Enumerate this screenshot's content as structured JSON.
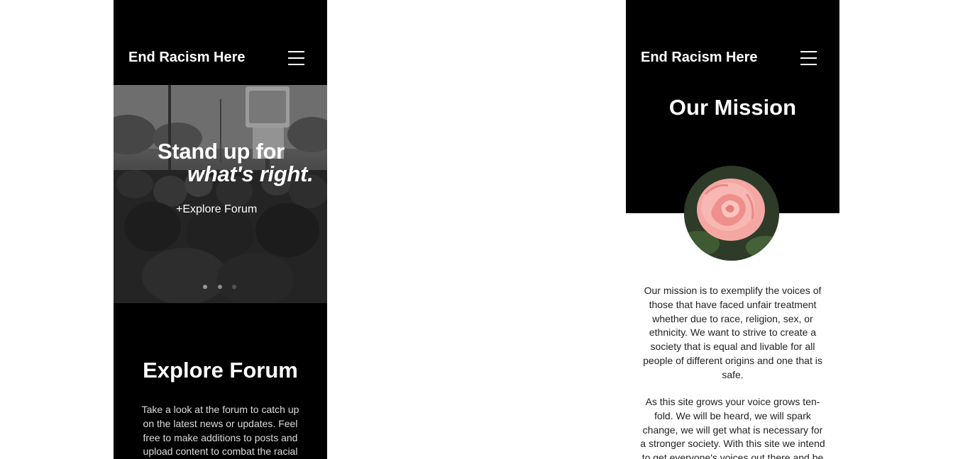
{
  "left_page": {
    "header": {
      "site_title": "End Racism Here",
      "menu_icon": "hamburger-menu-icon"
    },
    "hero": {
      "headline_line1": "Stand up for",
      "headline_line2": "what's right.",
      "cta_link": "+Explore Forum",
      "slides_count": 3,
      "active_slide": 1
    },
    "explore": {
      "title": "Explore Forum",
      "text": "Take a look at the forum to catch up on the latest news or updates. Feel free to make additions to posts and upload content to combat the racial"
    }
  },
  "right_page": {
    "header": {
      "site_title": "End Racism Here",
      "menu_icon": "hamburger-menu-icon"
    },
    "mission": {
      "title": "Our Mission",
      "image": "rose-image",
      "paragraph1": "Our mission is to exemplify the voices of those that have faced unfair treatment whether due to race, religion, sex, or ethnicity. We want to strive to create a society that is equal and livable for all people of different origins and one that is safe.",
      "paragraph2": "As this site grows your voice grows ten-fold. We will be heard, we will spark change, we will get what is necessary for a stronger society. With this site we intend to get everyone's voices out there and be"
    }
  },
  "colors": {
    "background": "#ffffff",
    "header_bg": "#000000",
    "text_light": "#ffffff",
    "text_dark": "#222222",
    "dot_active": "#9a9a9a",
    "dot_inactive": "#555555"
  }
}
